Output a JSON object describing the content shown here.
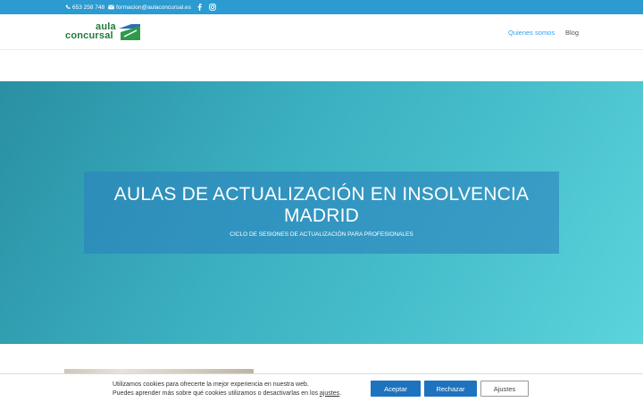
{
  "topbar": {
    "phone": "653 258 748",
    "email": "formacion@aulaconcursal.es",
    "icons": [
      "phone-icon",
      "envelope-icon",
      "facebook-icon",
      "instagram-icon"
    ]
  },
  "header": {
    "logo_line1": "aula",
    "logo_line2": "concursal",
    "nav": [
      {
        "label": "Quienes somos",
        "active": true
      },
      {
        "label": "Blog",
        "active": false
      }
    ]
  },
  "hero": {
    "title_line1": "AULAS DE ACTUALIZACIÓN EN INSOLVENCIA",
    "title_line2": "MADRID",
    "subtitle": "CICLO DE SESIONES DE ACTUALIZACIÓN PARA PROFESIONALES"
  },
  "cookie": {
    "line1": "Utilizamos cookies para ofrecerte la mejor experiencia en nuestra web.",
    "line2_prefix": "Puedes aprender más sobre qué cookies utilizamos o desactivarlas en los",
    "line2_link": "ajustes",
    "line2_suffix": ".",
    "accept": "Aceptar",
    "reject": "Rechazar",
    "settings": "Ajustes"
  },
  "colors": {
    "topbar": "#2b9bd1",
    "accent": "#2ea3f2",
    "logo_green": "#1f7a3a",
    "button_blue": "#1e73be"
  }
}
